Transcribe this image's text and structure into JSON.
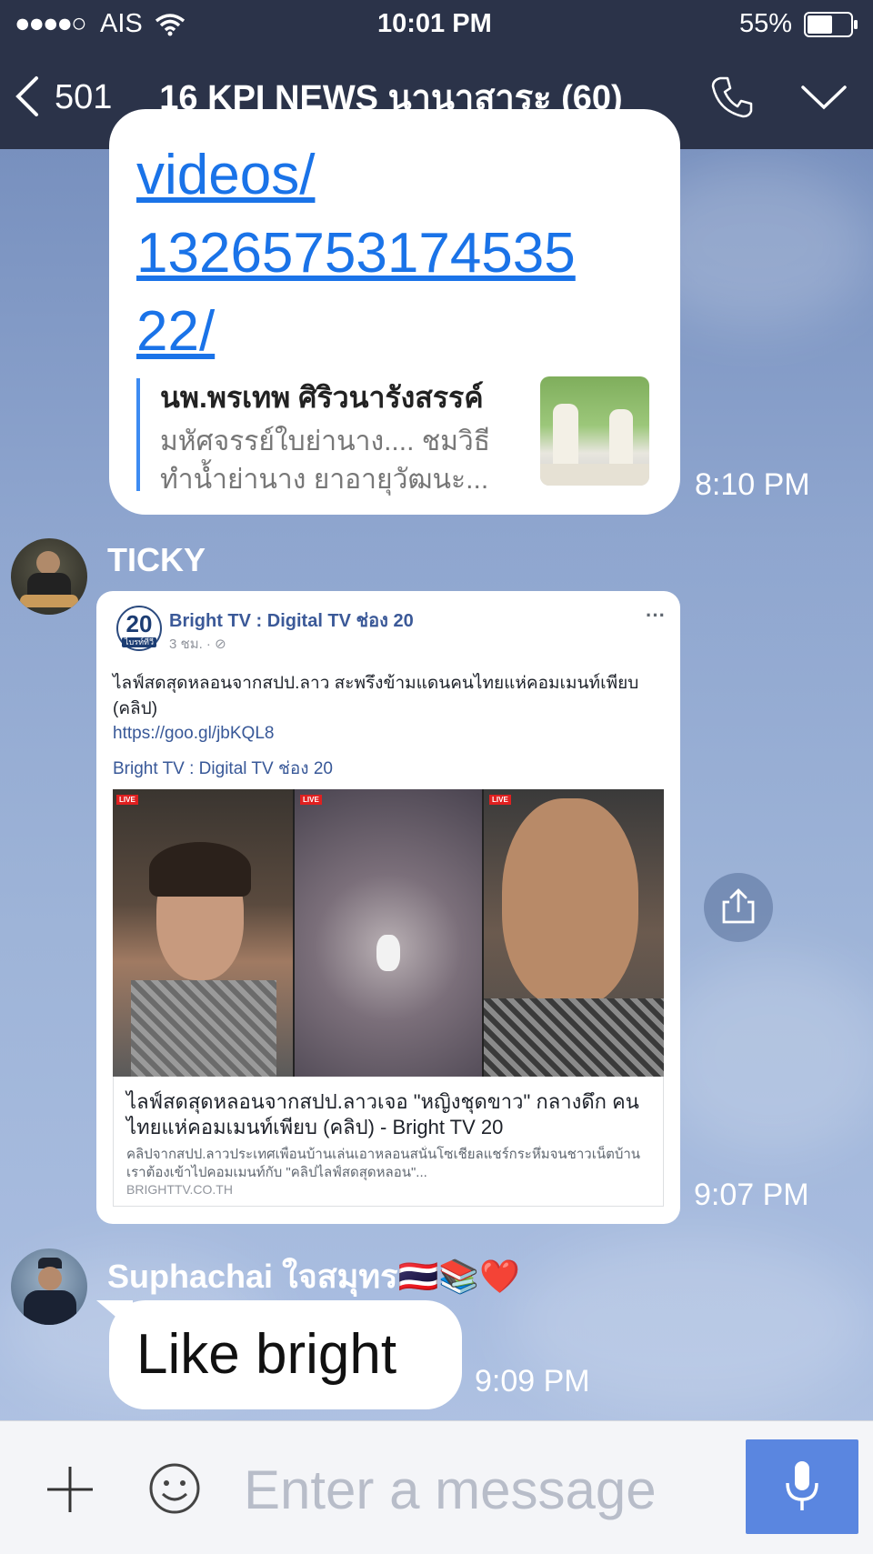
{
  "status_bar": {
    "signal": "●●●●○",
    "carrier": "AIS",
    "time": "10:01 PM",
    "battery": "55%"
  },
  "header": {
    "back_count": "501",
    "title": "16 KPI NEWS นานาสาระ (60)",
    "page_indicators": 3,
    "active_page": 0
  },
  "messages": {
    "first": {
      "link_lines": [
        "videos/",
        "13265753174535",
        "22/"
      ],
      "preview_title": "นพ.พรเทพ ศิริวนารังสรรค์",
      "preview_desc_1": "มหัศจรรย์ใบย่านาง.... ชมวิธี",
      "preview_desc_2": "ทำน้ำย่านาง ยาอายุวัฒนะ...",
      "time": "8:10 PM"
    },
    "ticky": {
      "sender": "TICKY",
      "page_badge": "20",
      "page_badge_sub": "ไบรท์ทีวี",
      "page_name": "Bright TV : Digital TV ช่อง 20",
      "post_time": "3 ชม. · ⊘",
      "more": "···",
      "post_text": "ไลฟ์สดสุดหลอนจากสปป.ลาว สะพรึงข้ามแดนคนไทยแห่คอมเมนท์เพียบ (คลิป)",
      "post_link": "https://goo.gl/jbKQL8",
      "post_source": "Bright TV : Digital TV ช่อง 20",
      "card_title": "ไลฟ์สดสุดหลอนจากสปป.ลาวเจอ \"หญิงชุดขาว\" กลางดึก คนไทยแห่คอมเมนท์เพียบ (คลิป) - Bright TV 20",
      "card_desc": "คลิปจากสปป.ลาวประเทศเพื่อนบ้านเล่นเอาหลอนสนั่นโซเชียลแชร์กระหึ่มจนชาวเน็ตบ้านเราต้องเข้าไปคอมเมนท์กับ \"คลิปไลฟ์สดสุดหลอน\"...",
      "card_domain": "BRIGHTTV.CO.TH",
      "live_badge": "LIVE",
      "time": "9:07 PM"
    },
    "suphachai": {
      "sender": "Suphachai ใจสมุทร🇹🇭📚❤️",
      "text": "Like bright",
      "time": "9:09 PM"
    }
  },
  "input": {
    "placeholder": "Enter a message"
  },
  "colors": {
    "nav_bg": "#2b3349",
    "link": "#1a73e8",
    "send_button": "#5a86e0"
  },
  "icons": [
    "wifi-icon",
    "battery-icon",
    "back-chevron-icon",
    "phone-icon",
    "chevron-down-icon",
    "share-icon",
    "plus-icon",
    "emoji-icon",
    "microphone-icon"
  ]
}
